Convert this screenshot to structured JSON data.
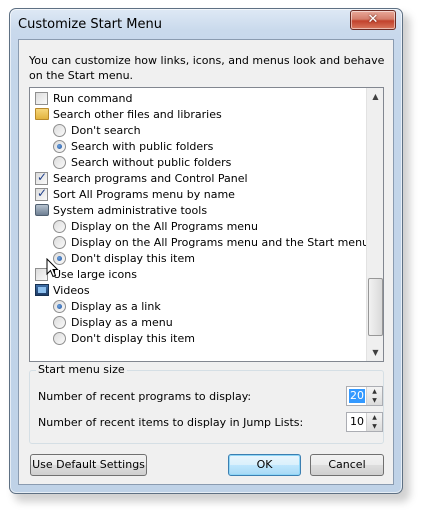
{
  "window": {
    "title": "Customize Start Menu",
    "close_label": "✕"
  },
  "intro_text": "You can customize how links, icons, and menus look and behave on the Start menu.",
  "list_items": [
    {
      "kind": "checkbox",
      "label": "Run command",
      "checked": false,
      "indent": 0
    },
    {
      "kind": "folder-icon",
      "label": "Search other files and libraries",
      "indent": 0
    },
    {
      "kind": "radio",
      "label": "Don't search",
      "checked": false,
      "indent": 1
    },
    {
      "kind": "radio",
      "label": "Search with public folders",
      "checked": true,
      "indent": 1
    },
    {
      "kind": "radio",
      "label": "Search without public folders",
      "checked": false,
      "indent": 1
    },
    {
      "kind": "checkbox",
      "label": "Search programs and Control Panel",
      "checked": true,
      "indent": 0
    },
    {
      "kind": "checkbox",
      "label": "Sort All Programs menu by name",
      "checked": true,
      "indent": 0
    },
    {
      "kind": "admin-icon",
      "label": "System administrative tools",
      "indent": 0
    },
    {
      "kind": "radio",
      "label": "Display on the All Programs menu",
      "checked": false,
      "indent": 1
    },
    {
      "kind": "radio",
      "label": "Display on the All Programs menu and the Start menu",
      "checked": false,
      "indent": 1
    },
    {
      "kind": "radio",
      "label": "Don't display this item",
      "checked": true,
      "indent": 1
    },
    {
      "kind": "checkbox",
      "label": "Use large icons",
      "checked": false,
      "indent": 0
    },
    {
      "kind": "video-icon",
      "label": "Videos",
      "indent": 0
    },
    {
      "kind": "radio",
      "label": "Display as a link",
      "checked": true,
      "indent": 1
    },
    {
      "kind": "radio",
      "label": "Display as a menu",
      "checked": false,
      "indent": 1
    },
    {
      "kind": "radio",
      "label": "Don't display this item",
      "checked": false,
      "indent": 1
    }
  ],
  "start_menu_size": {
    "legend": "Start menu size",
    "recent_programs_label": "Number of recent programs to display:",
    "recent_programs_value": "20",
    "jump_list_label": "Number of recent items to display in Jump Lists:",
    "jump_list_value": "10"
  },
  "buttons": {
    "defaults_label": "Use Default Settings",
    "ok_label": "OK",
    "cancel_label": "Cancel"
  }
}
